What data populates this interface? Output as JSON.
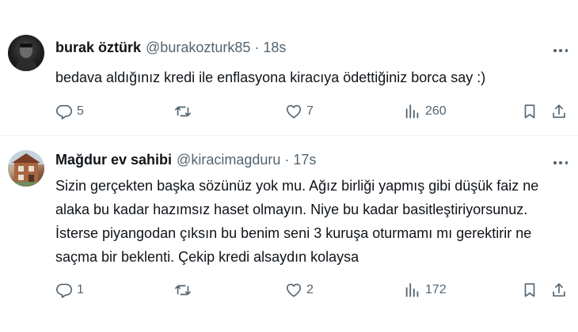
{
  "tweets": [
    {
      "author": {
        "name": "burak öztürk",
        "handle": "@burakozturk85",
        "avatar_icon": "profile-photo-dark"
      },
      "separator": "·",
      "time": "18s",
      "text_lines": [
        "bedava aldığınız kredi ile enflasyona kiracıya ödettiğiniz borca say :)"
      ],
      "actions": {
        "replies": "5",
        "reposts": "",
        "likes": "7",
        "views": "260"
      }
    },
    {
      "author": {
        "name": "Mağdur ev sahibi",
        "handle": "@kiracimagduru",
        "avatar_icon": "profile-photo-building"
      },
      "separator": "·",
      "time": "17s",
      "text_lines": [
        "Sizin gerçekten başka sözünüz yok mu. Ağız birliği yapmış gibi düşük faiz ne",
        "alaka bu kadar hazımsız haset olmayın. Niye bu kadar basitleştiriyorsunuz.",
        "İsterse piyangodan çıksın bu benim seni 3 kuruşa oturmamı mı gerektirir ne",
        "saçma bir beklenti. Çekip kredi alsaydın kolaysa"
      ],
      "actions": {
        "replies": "1",
        "reposts": "",
        "likes": "2",
        "views": "172"
      }
    }
  ],
  "colors": {
    "text": "#0f1419",
    "secondary": "#536471",
    "divider": "#eff3f4",
    "background": "#ffffff"
  }
}
